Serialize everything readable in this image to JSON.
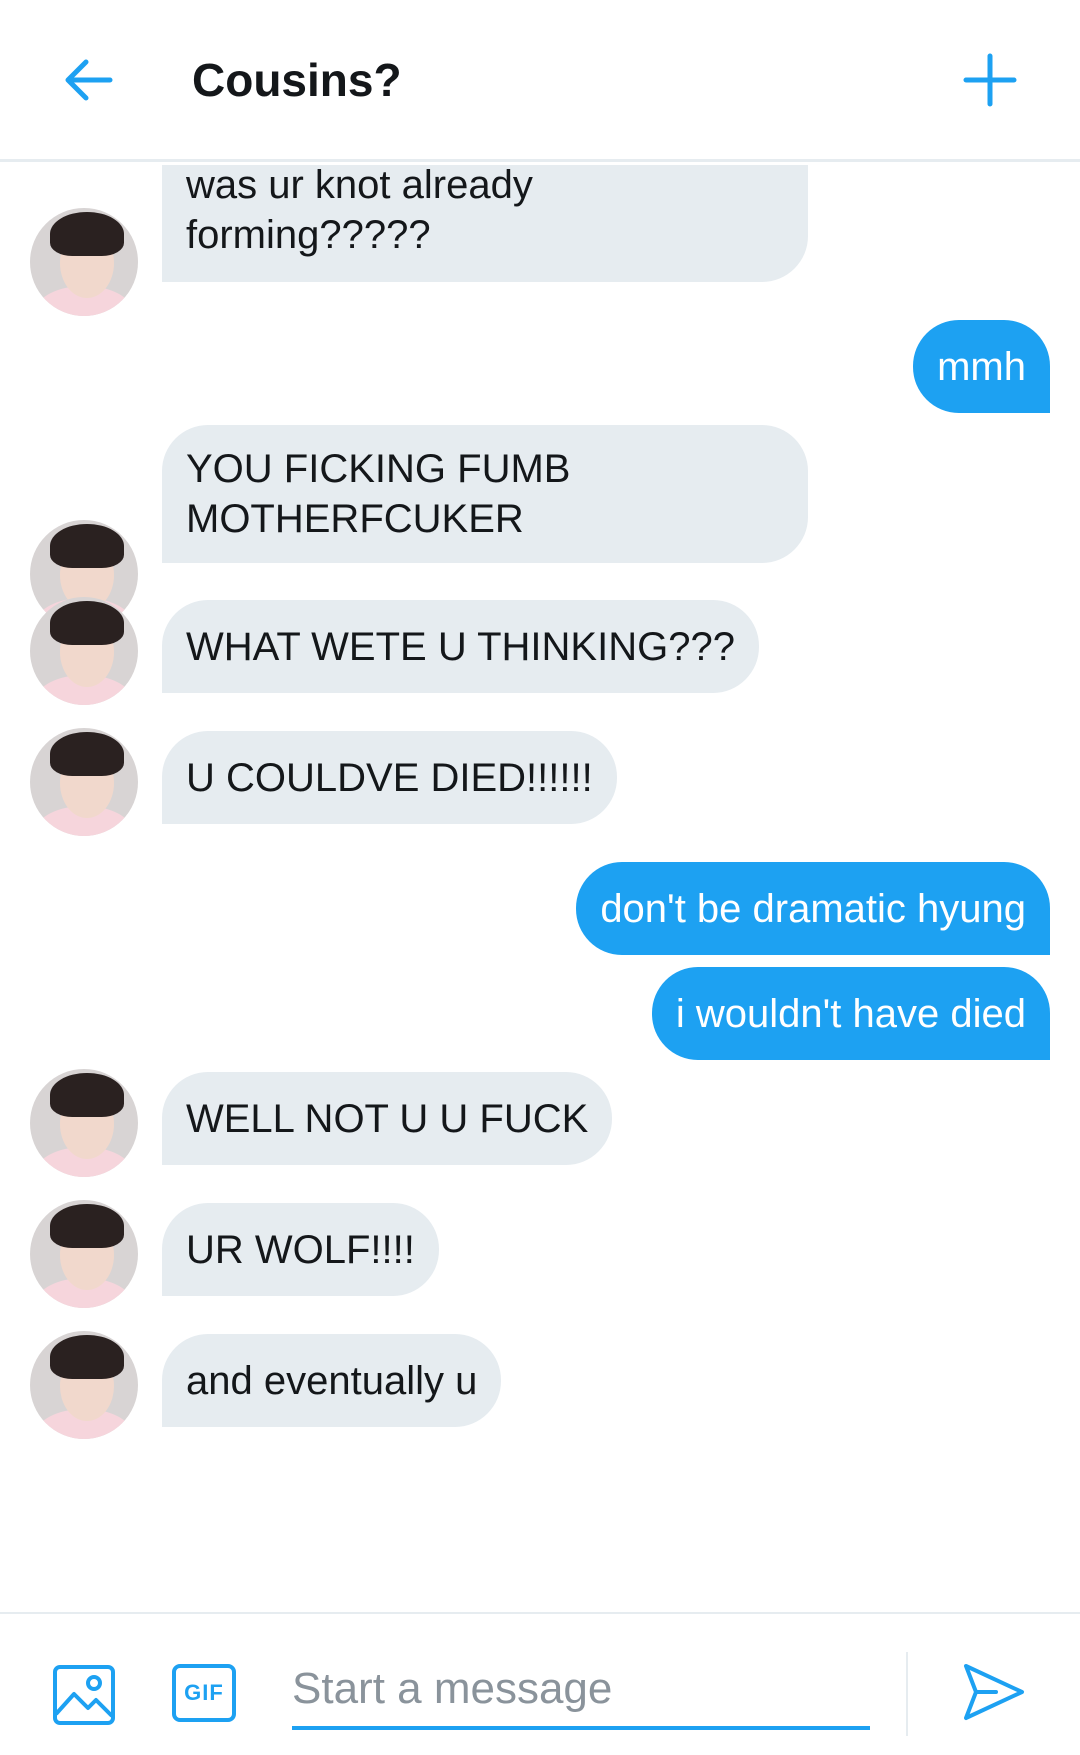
{
  "header": {
    "title": "Cousins?",
    "back_icon": "arrow-left-icon",
    "new_icon": "plus-icon"
  },
  "colors": {
    "accent": "#1da1f2",
    "incoming_bubble": "#e6ecf0",
    "text": "#14171a"
  },
  "messages": [
    {
      "from": "them",
      "lines": [
        "was ur knot already",
        "forming?????"
      ]
    },
    {
      "from": "me",
      "lines": [
        "mmh"
      ]
    },
    {
      "from": "them",
      "lines": [
        "YOU FICKING FUMB",
        "MOTHERFCUKER"
      ]
    },
    {
      "from": "them",
      "lines": [
        "WHAT WETE U THINKING???"
      ]
    },
    {
      "from": "them",
      "lines": [
        "U COULDVE DIED!!!!!!"
      ]
    },
    {
      "from": "me",
      "lines": [
        "don't be dramatic hyung"
      ]
    },
    {
      "from": "me",
      "lines": [
        "i wouldn't have died"
      ]
    },
    {
      "from": "them",
      "lines": [
        "WELL NOT U U FUCK"
      ]
    },
    {
      "from": "them",
      "lines": [
        "UR WOLF!!!!"
      ]
    },
    {
      "from": "them",
      "lines": [
        "and eventually u"
      ]
    }
  ],
  "composer": {
    "placeholder": "Start a message",
    "value": "",
    "gif_label": "GIF",
    "media_icon": "image-icon",
    "send_icon": "send-icon"
  }
}
